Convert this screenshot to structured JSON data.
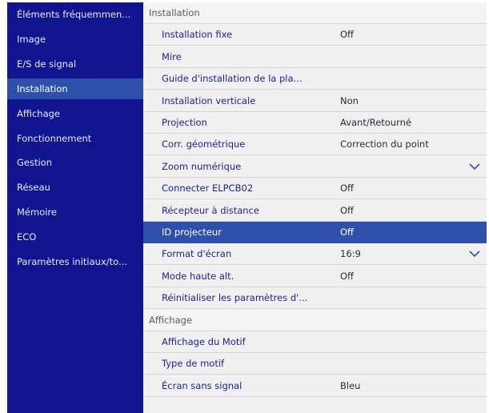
{
  "sidebar": {
    "items": [
      {
        "label": "Éléments fréquemmen...",
        "active": false
      },
      {
        "label": "Image",
        "active": false
      },
      {
        "label": "E/S de signal",
        "active": false
      },
      {
        "label": "Installation",
        "active": true
      },
      {
        "label": "Affichage",
        "active": false
      },
      {
        "label": "Fonctionnement",
        "active": false
      },
      {
        "label": "Gestion",
        "active": false
      },
      {
        "label": "Réseau",
        "active": false
      },
      {
        "label": "Mémoire",
        "active": false
      },
      {
        "label": "ECO",
        "active": false
      },
      {
        "label": "Paramètres initiaux/to...",
        "active": false
      }
    ]
  },
  "main": {
    "rows": [
      {
        "type": "header",
        "label": "Installation"
      },
      {
        "type": "item",
        "label": "Installation fixe",
        "value": "Off"
      },
      {
        "type": "item",
        "label": "Mire"
      },
      {
        "type": "item",
        "label": "Guide d'installation de la pla..."
      },
      {
        "type": "item",
        "label": "Installation verticale",
        "value": "Non"
      },
      {
        "type": "item",
        "label": "Projection",
        "value": "Avant/Retourné"
      },
      {
        "type": "item",
        "label": "Corr. géométrique",
        "value": "Correction du point"
      },
      {
        "type": "item",
        "label": "Zoom numérique",
        "icon": "chevron-down-icon"
      },
      {
        "type": "item",
        "label": "Connecter ELPCB02",
        "value": "Off"
      },
      {
        "type": "item",
        "label": "Récepteur à distance",
        "value": "Off"
      },
      {
        "type": "item",
        "label": "ID projecteur",
        "value": "Off",
        "selected": true
      },
      {
        "type": "item",
        "label": "Format d'écran",
        "value": "16:9",
        "icon": "chevron-down-icon"
      },
      {
        "type": "item",
        "label": "Mode haute alt.",
        "value": "Off"
      },
      {
        "type": "item",
        "label": "Réinitialiser les paramètres d'..."
      },
      {
        "type": "header",
        "label": "Affichage"
      },
      {
        "type": "item",
        "label": "Affichage du Motif"
      },
      {
        "type": "item",
        "label": "Type de motif"
      },
      {
        "type": "item",
        "label": "Écran sans signal",
        "value": "Bleu"
      }
    ]
  },
  "colors": {
    "sidebar_bg": "#10158f",
    "selection": "#2e50ab",
    "panel_bg": "#f1f0f1",
    "item_text": "#1b1f8d"
  }
}
